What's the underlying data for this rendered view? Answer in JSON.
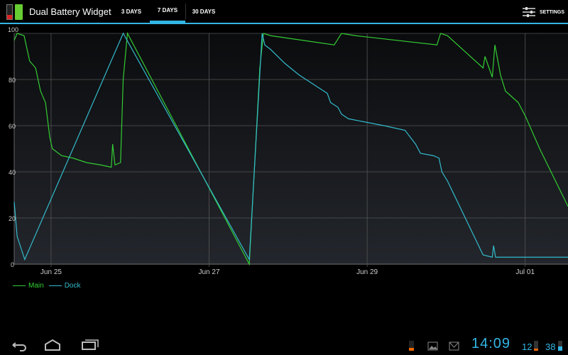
{
  "app": {
    "title": "Dual Battery Widget"
  },
  "tabs": [
    {
      "label": "3 DAYS"
    },
    {
      "label": "7 DAYS",
      "selected": true
    },
    {
      "label": "30 DAYS"
    }
  ],
  "settings_label": "SETTINGS",
  "chart_data": {
    "type": "line",
    "x_unit": "hours since Jun 25 00:00",
    "xlim": [
      -11.2,
      157
    ],
    "ylim": [
      0,
      100
    ],
    "yticks": [
      0,
      20,
      40,
      60,
      80,
      100
    ],
    "xticks": [
      {
        "x": 0,
        "label": "Jun 25"
      },
      {
        "x": 48,
        "label": "Jun 27"
      },
      {
        "x": 96,
        "label": "Jun 29"
      },
      {
        "x": 144,
        "label": "Jul 01"
      }
    ],
    "grid": true,
    "legend_position": "bottom-left",
    "series": [
      {
        "name": "Main",
        "color": "#33cc33",
        "points": [
          [
            -11.2,
            97
          ],
          [
            -10.3,
            100
          ],
          [
            -8.2,
            99
          ],
          [
            -6.5,
            88
          ],
          [
            -4.7,
            85
          ],
          [
            -3.2,
            75
          ],
          [
            -1.7,
            70
          ],
          [
            -0.4,
            55
          ],
          [
            0.4,
            50
          ],
          [
            3.2,
            47
          ],
          [
            6.5,
            46
          ],
          [
            10.8,
            44
          ],
          [
            15.0,
            43
          ],
          [
            18.3,
            42
          ],
          [
            18.7,
            52
          ],
          [
            19.4,
            43
          ],
          [
            21.1,
            44
          ],
          [
            21.9,
            80
          ],
          [
            23.2,
            100
          ],
          [
            60.2,
            0
          ],
          [
            63.4,
            85
          ],
          [
            64.5,
            100
          ],
          [
            66.7,
            99
          ],
          [
            86.0,
            95
          ],
          [
            88.2,
            100
          ],
          [
            92.5,
            99
          ],
          [
            117.2,
            95
          ],
          [
            118.3,
            100
          ],
          [
            120.4,
            99
          ],
          [
            131.2,
            85
          ],
          [
            131.8,
            90
          ],
          [
            134.0,
            81
          ],
          [
            134.8,
            95
          ],
          [
            136.5,
            82
          ],
          [
            138.0,
            75
          ],
          [
            141.9,
            70
          ],
          [
            144.1,
            64
          ],
          [
            148.4,
            50
          ],
          [
            157.0,
            25
          ]
        ]
      },
      {
        "name": "Dock",
        "color": "#33bbcc",
        "points": [
          [
            -11.2,
            27
          ],
          [
            -10.3,
            12
          ],
          [
            -8.0,
            2
          ],
          [
            21.9,
            100
          ],
          [
            60.2,
            2
          ],
          [
            64.1,
            100
          ],
          [
            64.9,
            95
          ],
          [
            66.7,
            93
          ],
          [
            71.0,
            87
          ],
          [
            75.3,
            82
          ],
          [
            79.6,
            78
          ],
          [
            83.9,
            74
          ],
          [
            84.9,
            70
          ],
          [
            87.1,
            68
          ],
          [
            88.2,
            65
          ],
          [
            90.3,
            63
          ],
          [
            101.1,
            60
          ],
          [
            107.5,
            58
          ],
          [
            110.7,
            52
          ],
          [
            112.2,
            48
          ],
          [
            116.1,
            47
          ],
          [
            117.8,
            46
          ],
          [
            118.7,
            40
          ],
          [
            120.4,
            36
          ],
          [
            131.2,
            4
          ],
          [
            134.0,
            3
          ],
          [
            134.4,
            8
          ],
          [
            135.0,
            3
          ],
          [
            157.0,
            3
          ]
        ]
      }
    ]
  },
  "status": {
    "time": "14:09",
    "battery1": "12",
    "battery2": "38"
  }
}
